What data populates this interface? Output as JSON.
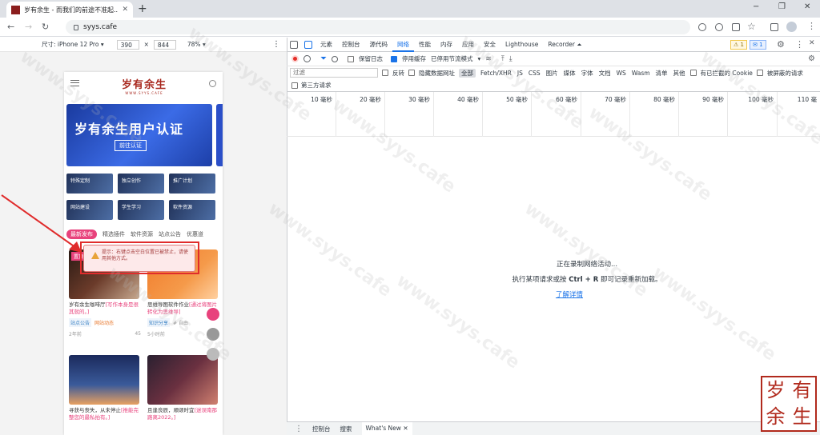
{
  "browser": {
    "tab_title": "岁有余生 - 而我们的前途不准起...",
    "url": "syys.cafe",
    "new_tab": "+",
    "window_controls": [
      "−",
      "❐",
      "✕"
    ]
  },
  "device_toolbar": {
    "device": "尺寸: iPhone 12 Pro ▾",
    "width": "390",
    "times": "×",
    "height": "844",
    "zoom": "78% ▾"
  },
  "phone": {
    "logo_text": "岁有余生",
    "logo_sub": "WWW.SYYS.CAFE",
    "banner_title": "岁有余生用户认证",
    "banner_button": "前往认证",
    "categories": [
      "特殊定制",
      "独立创作",
      "推广计划",
      "网站建设",
      "学生学习",
      "软件资源"
    ],
    "tabs": [
      "最新发布",
      "精选插件",
      "软件资源",
      "站点公告",
      "优惠道"
    ],
    "cards": [
      {
        "ribbon": "置顶",
        "title": "岁有余生咖啡厅",
        "title_link": "[写作本身是很其就的。]",
        "tag1": "站点公告",
        "tag2": "网站动态",
        "time": "2年前",
        "likes": "45"
      },
      {
        "title": "思维导图软件作业",
        "title_link": "[通过将图片转化为思维导]",
        "tag1": "知识分享",
        "tag2": "# 自由",
        "time": "5小时前",
        "likes": ""
      },
      {
        "title": "寻获与丧失，从未停止",
        "title_link": "[推能完整您的最私拍有。]",
        "time": "",
        "likes": ""
      },
      {
        "title": "且逢良辰，顺颂时宜",
        "title_link": "[迷误南那路离2022。]",
        "time": "",
        "likes": ""
      }
    ]
  },
  "toast": {
    "text": "提示：右键点击空白位置已被禁止，请使用其他方式。"
  },
  "devtools": {
    "tabs": [
      "元素",
      "控制台",
      "源代码",
      "网络",
      "性能",
      "内存",
      "应用",
      "安全",
      "Lighthouse",
      "Recorder ⏶"
    ],
    "selected_tab": "网络",
    "warnings": "1",
    "messages": "1",
    "controls": {
      "preserve_log": "保留日志",
      "disable_cache": "停用缓存",
      "throttle": "已停用节流模式",
      "throttle_arrow": "▾"
    },
    "filter": {
      "placeholder": "过滤",
      "invert": "反转",
      "hide_data": "隐藏数据网址",
      "types": [
        "全部",
        "Fetch/XHR",
        "JS",
        "CSS",
        "图片",
        "媒体",
        "字体",
        "文档",
        "WS",
        "Wasm",
        "清单",
        "其他"
      ],
      "blocked_cookies": "有已拦截的 Cookie",
      "blocked_requests": "被屏蔽的请求",
      "third_party": "第三方请求"
    },
    "timeline_ticks": [
      "10 毫秒",
      "20 毫秒",
      "30 毫秒",
      "40 毫秒",
      "50 毫秒",
      "60 毫秒",
      "70 毫秒",
      "80 毫秒",
      "90 毫秒",
      "100 毫秒",
      "110 毫"
    ],
    "empty_line1": "正在录制网络活动...",
    "empty_line2_pre": "执行某项请求或按 ",
    "empty_line2_key": "Ctrl + R",
    "empty_line2_post": " 即可记录重新加载。",
    "learn_more": "了解详情",
    "drawer_tabs": [
      "控制台",
      "搜索",
      "What's New"
    ],
    "drawer_close": "✕"
  },
  "watermark": "www.syys.cafe",
  "seal_chars": [
    "岁",
    "有",
    "余",
    "生"
  ]
}
